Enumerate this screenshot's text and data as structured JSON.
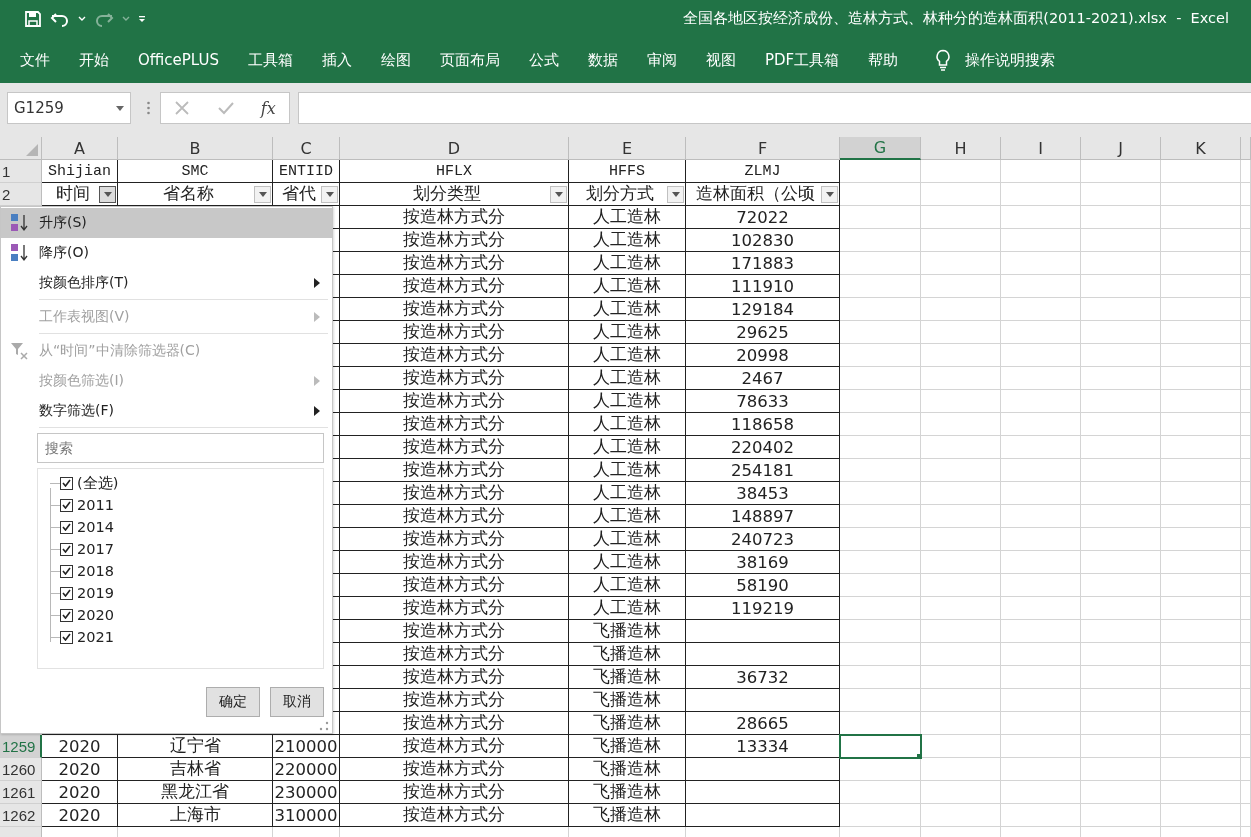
{
  "window": {
    "title": "全国各地区按经济成份、造林方式、林种分的造林面积(2011-2021).xlsx  -  Excel"
  },
  "ribbon_tabs": [
    "文件",
    "开始",
    "OfficePLUS",
    "工具箱",
    "插入",
    "绘图",
    "页面布局",
    "公式",
    "数据",
    "审阅",
    "视图",
    "PDF工具箱",
    "帮助"
  ],
  "tell_me": {
    "placeholder": "操作说明搜索"
  },
  "formula_bar": {
    "name_box": "G1259",
    "function_label": "fx"
  },
  "sheet": {
    "columns": [
      {
        "label": "A",
        "selected": false
      },
      {
        "label": "B",
        "selected": false
      },
      {
        "label": "C",
        "selected": false
      },
      {
        "label": "D",
        "selected": false
      },
      {
        "label": "E",
        "selected": false
      },
      {
        "label": "F",
        "selected": false
      },
      {
        "label": "G",
        "selected": true
      },
      {
        "label": "H",
        "selected": false
      },
      {
        "label": "I",
        "selected": false
      },
      {
        "label": "J",
        "selected": false
      },
      {
        "label": "K",
        "selected": false
      }
    ],
    "rows": [
      {
        "kind": "codes",
        "number": "1",
        "selected": false,
        "cells": {
          "A": "Shijian",
          "B": "SMC",
          "C": "ENTIID",
          "D": "HFLX",
          "E": "HFFS",
          "F": "ZLMJ"
        }
      },
      {
        "kind": "filters",
        "number": "2",
        "selected": false,
        "cells": {
          "A": {
            "text": "时间",
            "filter_open": true
          },
          "B": {
            "text": "省名称",
            "filter_open": false
          },
          "C": {
            "text": "省代",
            "filter_open": false
          },
          "D": {
            "text": "划分类型",
            "filter_open": false
          },
          "E": {
            "text": "划分方式",
            "filter_open": false
          },
          "F": {
            "text": "造林面积（公顷",
            "filter_open": false
          }
        }
      },
      {
        "kind": "data",
        "cells": {
          "D": "按造林方式分",
          "E": "人工造林",
          "F": "72022"
        }
      },
      {
        "kind": "data",
        "cells": {
          "D": "按造林方式分",
          "E": "人工造林",
          "F": "102830"
        }
      },
      {
        "kind": "data",
        "cells": {
          "D": "按造林方式分",
          "E": "人工造林",
          "F": "171883"
        }
      },
      {
        "kind": "data",
        "cells": {
          "D": "按造林方式分",
          "E": "人工造林",
          "F": "111910"
        }
      },
      {
        "kind": "data",
        "cells": {
          "D": "按造林方式分",
          "E": "人工造林",
          "F": "129184"
        }
      },
      {
        "kind": "data",
        "cells": {
          "D": "按造林方式分",
          "E": "人工造林",
          "F": "29625"
        }
      },
      {
        "kind": "data",
        "cells": {
          "D": "按造林方式分",
          "E": "人工造林",
          "F": "20998"
        }
      },
      {
        "kind": "data",
        "cells": {
          "D": "按造林方式分",
          "E": "人工造林",
          "F": "2467"
        }
      },
      {
        "kind": "data",
        "cells": {
          "D": "按造林方式分",
          "E": "人工造林",
          "F": "78633"
        }
      },
      {
        "kind": "data",
        "cells": {
          "D": "按造林方式分",
          "E": "人工造林",
          "F": "118658"
        }
      },
      {
        "kind": "data",
        "cells": {
          "D": "按造林方式分",
          "E": "人工造林",
          "F": "220402"
        }
      },
      {
        "kind": "data",
        "cells": {
          "D": "按造林方式分",
          "E": "人工造林",
          "F": "254181"
        }
      },
      {
        "kind": "data",
        "cells": {
          "D": "按造林方式分",
          "E": "人工造林",
          "F": "38453"
        }
      },
      {
        "kind": "data",
        "cells": {
          "D": "按造林方式分",
          "E": "人工造林",
          "F": "148897"
        }
      },
      {
        "kind": "data",
        "cells": {
          "D": "按造林方式分",
          "E": "人工造林",
          "F": "240723"
        }
      },
      {
        "kind": "data",
        "cells": {
          "D": "按造林方式分",
          "E": "人工造林",
          "F": "38169"
        }
      },
      {
        "kind": "data",
        "cells": {
          "D": "按造林方式分",
          "E": "人工造林",
          "F": "58190"
        }
      },
      {
        "kind": "data",
        "cells": {
          "D": "按造林方式分",
          "E": "人工造林",
          "F": "119219"
        }
      },
      {
        "kind": "data",
        "cells": {
          "D": "按造林方式分",
          "E": "飞播造林"
        }
      },
      {
        "kind": "data",
        "cells": {
          "D": "按造林方式分",
          "E": "飞播造林"
        }
      },
      {
        "kind": "data",
        "cells": {
          "D": "按造林方式分",
          "E": "飞播造林",
          "F": "36732"
        }
      },
      {
        "kind": "data",
        "cells": {
          "D": "按造林方式分",
          "E": "飞播造林"
        }
      },
      {
        "kind": "data",
        "cells": {
          "D": "按造林方式分",
          "E": "飞播造林",
          "F": "28665"
        }
      },
      {
        "kind": "data",
        "number": "1259",
        "selected": true,
        "cells": {
          "A": "2020",
          "B": "辽宁省",
          "C": "210000",
          "D": "按造林方式分",
          "E": "飞播造林",
          "F": "13334"
        }
      },
      {
        "kind": "data",
        "number": "1260",
        "selected": false,
        "cells": {
          "A": "2020",
          "B": "吉林省",
          "C": "220000",
          "D": "按造林方式分",
          "E": "飞播造林"
        }
      },
      {
        "kind": "data",
        "number": "1261",
        "selected": false,
        "cells": {
          "A": "2020",
          "B": "黑龙江省",
          "C": "230000",
          "D": "按造林方式分",
          "E": "飞播造林"
        }
      },
      {
        "kind": "data",
        "number": "1262",
        "selected": false,
        "cells": {
          "A": "2020",
          "B": "上海市",
          "C": "310000",
          "D": "按造林方式分",
          "E": "飞播造林"
        }
      }
    ]
  },
  "filter_menu": {
    "items": [
      {
        "kind": "ascending",
        "label": "升序(S)",
        "highlighted": true,
        "disabled": false,
        "submenu": false
      },
      {
        "kind": "descending",
        "label": "降序(O)",
        "highlighted": false,
        "disabled": false,
        "submenu": false
      },
      {
        "kind": "command",
        "label": "按颜色排序(T)",
        "highlighted": false,
        "disabled": false,
        "submenu": true
      },
      {
        "kind": "separator"
      },
      {
        "kind": "command",
        "label": "工作表视图(V)",
        "highlighted": false,
        "disabled": true,
        "submenu": true
      },
      {
        "kind": "separator"
      },
      {
        "kind": "clear",
        "label": "从“时间”中清除筛选器(C)",
        "highlighted": false,
        "disabled": true,
        "submenu": false
      },
      {
        "kind": "command",
        "label": "按颜色筛选(I)",
        "highlighted": false,
        "disabled": true,
        "submenu": true
      },
      {
        "kind": "command",
        "label": "数字筛选(F)",
        "highlighted": false,
        "disabled": false,
        "submenu": true
      },
      {
        "kind": "separator"
      }
    ],
    "search": {
      "placeholder": "搜索"
    },
    "values": [
      {
        "label": "(全选)",
        "checked": true
      },
      {
        "label": "2011",
        "checked": true
      },
      {
        "label": "2014",
        "checked": true
      },
      {
        "label": "2017",
        "checked": true
      },
      {
        "label": "2018",
        "checked": true
      },
      {
        "label": "2019",
        "checked": true
      },
      {
        "label": "2020",
        "checked": true
      },
      {
        "label": "2021",
        "checked": true
      }
    ],
    "buttons": [
      "确定",
      "取消"
    ]
  }
}
